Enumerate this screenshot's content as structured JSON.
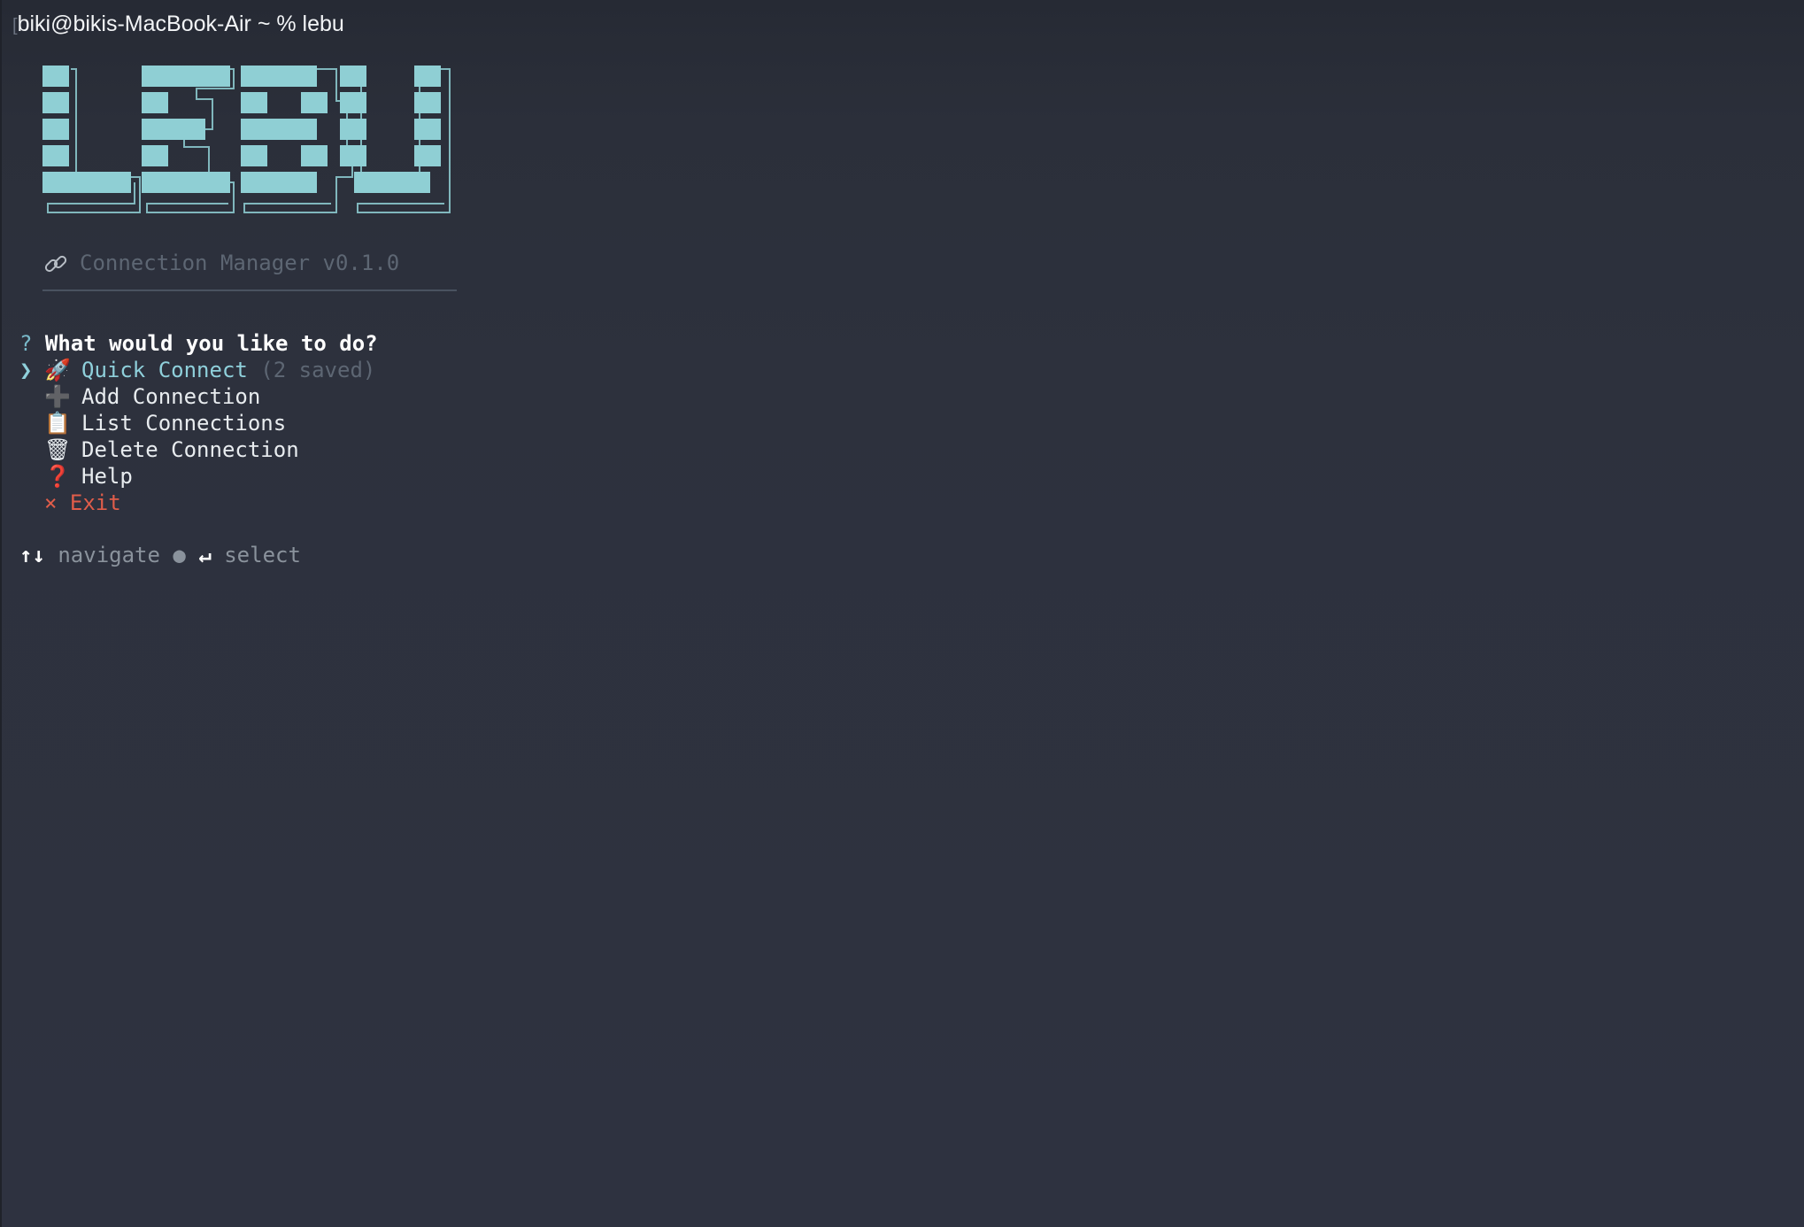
{
  "terminal": {
    "prompt_marker": "[",
    "prompt": "biki@bikis-MacBook-Air ~ % lebu"
  },
  "app": {
    "logo_text": "LEBU",
    "logo_color": "#8fcfd4",
    "subtitle_icon": "link-icon",
    "subtitle": "Connection Manager v0.1.0"
  },
  "question": {
    "mark": "?",
    "text": "What would you like to do?"
  },
  "menu": {
    "pointer": "❯",
    "items": [
      {
        "icon": "🚀",
        "icon_name": "rocket-icon",
        "label": "Quick Connect",
        "hint": " (2 saved)"
      },
      {
        "icon": "➕",
        "icon_name": "plus-icon",
        "label": "Add Connection"
      },
      {
        "icon": "📋",
        "icon_name": "clipboard-icon",
        "label": "List Connections"
      },
      {
        "icon": "🗑",
        "icon_name": "trash-icon",
        "label": "Delete Connection"
      },
      {
        "icon": "❓",
        "icon_name": "question-icon",
        "label": "Help"
      }
    ],
    "exit": {
      "icon": "×",
      "label": "Exit"
    }
  },
  "footer": {
    "arrows": "↑↓",
    "navigate": "navigate",
    "bullet": "●",
    "enter": "↵",
    "select": "select"
  },
  "colors": {
    "accent": "#8fd0db",
    "dim": "#5d6673",
    "exit": "#e05d4a",
    "background": "#2d313d"
  }
}
